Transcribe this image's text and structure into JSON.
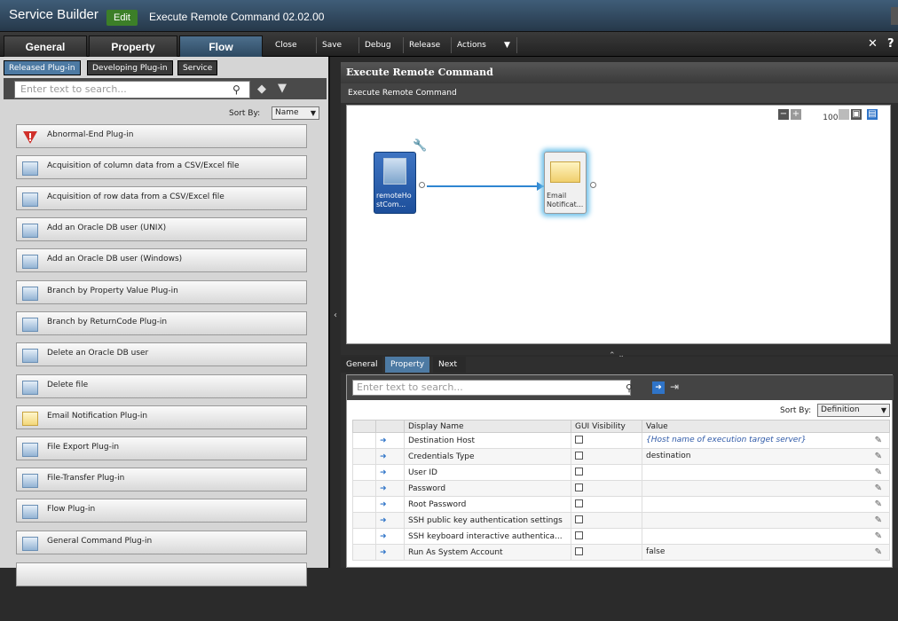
{
  "header": {
    "app_title": "Service Builder",
    "mode_badge": "Edit",
    "service_name": "Execute Remote Command 02.02.00"
  },
  "menubar": {
    "tabs": [
      "General",
      "Property",
      "Flow"
    ],
    "active_tab": "Flow",
    "buttons": [
      "Close",
      "Save",
      "Debug",
      "Release",
      "Actions"
    ],
    "actions_arrow": "▼",
    "right_icons": [
      "✕",
      "?"
    ]
  },
  "left_panel": {
    "tabs": [
      "Released Plug-in",
      "Developing Plug-in",
      "Service"
    ],
    "active_tab": "Released Plug-in",
    "search_placeholder": "Enter text to search...",
    "sort_label": "Sort By:",
    "sort_value": "Name",
    "plugins": [
      {
        "label": "Abnormal-End Plug-in",
        "icon": "error-icon"
      },
      {
        "label": "Acquisition of column data from a CSV/Excel file",
        "icon": "component-icon"
      },
      {
        "label": "Acquisition of row data from a CSV/Excel file",
        "icon": "component-icon"
      },
      {
        "label": "Add an Oracle DB user (UNIX)",
        "icon": "component-icon"
      },
      {
        "label": "Add an Oracle DB user (Windows)",
        "icon": "component-icon"
      },
      {
        "label": "Branch by Property Value Plug-in",
        "icon": "branch-icon"
      },
      {
        "label": "Branch by ReturnCode Plug-in",
        "icon": "branch-icon"
      },
      {
        "label": "Delete an Oracle DB user",
        "icon": "component-icon"
      },
      {
        "label": "Delete file",
        "icon": "component-icon"
      },
      {
        "label": "Email Notification Plug-in",
        "icon": "mail-icon"
      },
      {
        "label": "File Export Plug-in",
        "icon": "export-icon"
      },
      {
        "label": "File-Transfer Plug-in",
        "icon": "transfer-icon"
      },
      {
        "label": "Flow Plug-in",
        "icon": "flow-icon"
      },
      {
        "label": "General Command Plug-in",
        "icon": "command-icon"
      }
    ]
  },
  "canvas_panel": {
    "title": "Execute Remote Command",
    "breadcrumb": "Execute Remote Command",
    "zoom_level": "100%",
    "nodes": [
      {
        "label_line1": "remoteHo",
        "label_line2": "stCom..."
      },
      {
        "label_line1": "Email",
        "label_line2": "Notificat..."
      }
    ]
  },
  "property_panel": {
    "tabs": [
      "General",
      "Property",
      "Next Steps"
    ],
    "active_tab": "Property",
    "search_placeholder": "Enter text to search...",
    "sort_label": "Sort By:",
    "sort_value": "Definition",
    "columns": [
      "Display Name",
      "GUI Visibility",
      "Value"
    ],
    "rows": [
      {
        "name": "Destination Host",
        "value": "{Host name of execution target server}",
        "italic": true
      },
      {
        "name": "Credentials Type",
        "value": "destination",
        "italic": false
      },
      {
        "name": "User ID",
        "value": "",
        "italic": false
      },
      {
        "name": "Password",
        "value": "",
        "italic": false
      },
      {
        "name": "Root Password",
        "value": "",
        "italic": false
      },
      {
        "name": "SSH public key authentication settings",
        "value": "",
        "italic": false
      },
      {
        "name": "SSH keyboard interactive authentica...",
        "value": "",
        "italic": false
      },
      {
        "name": "Run As System Account",
        "value": "false",
        "italic": false
      }
    ]
  },
  "colors": {
    "accent_blue": "#4d7aa3",
    "edit_green": "#3c7f28",
    "connector_blue": "#2f86d1"
  }
}
